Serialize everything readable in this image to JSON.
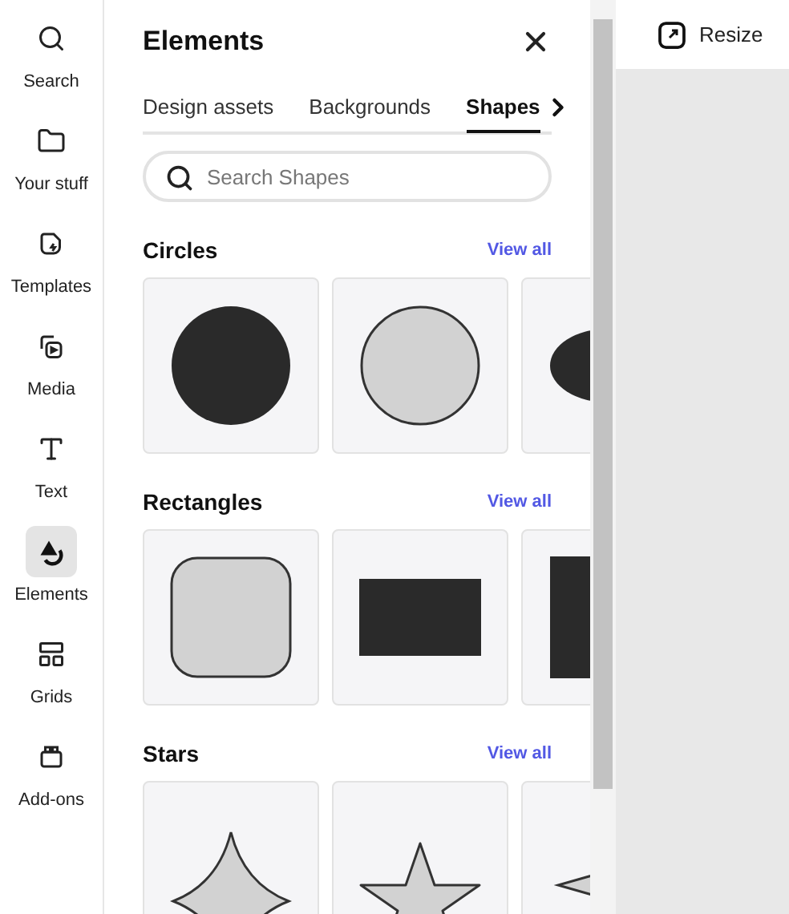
{
  "rail": [
    {
      "label": "Search",
      "kind": "search",
      "selected": false
    },
    {
      "label": "Your stuff",
      "kind": "folder",
      "selected": false
    },
    {
      "label": "Templates",
      "kind": "templates",
      "selected": false
    },
    {
      "label": "Media",
      "kind": "media",
      "selected": false
    },
    {
      "label": "Text",
      "kind": "text",
      "selected": false
    },
    {
      "label": "Elements",
      "kind": "elements",
      "selected": true
    },
    {
      "label": "Grids",
      "kind": "grids",
      "selected": false
    },
    {
      "label": "Add-ons",
      "kind": "addons",
      "selected": false
    }
  ],
  "panel": {
    "title": "Elements",
    "tabs": [
      {
        "label": "Design assets",
        "selected": false
      },
      {
        "label": "Backgrounds",
        "selected": false
      },
      {
        "label": "Shapes",
        "selected": true
      }
    ],
    "search": {
      "placeholder": "Search Shapes"
    },
    "sections": [
      {
        "title": "Circles",
        "link": "View all",
        "tiles": [
          {
            "kind": "dark-circle"
          },
          {
            "kind": "light-circle"
          },
          {
            "kind": "dark-ellipse"
          }
        ]
      },
      {
        "title": "Rectangles",
        "link": "View all",
        "tiles": [
          {
            "kind": "rounded-square"
          },
          {
            "kind": "dark-rectangle"
          },
          {
            "kind": "dark-tall-rectangle"
          }
        ]
      },
      {
        "title": "Stars",
        "link": "View all",
        "tiles": [
          {
            "kind": "four-point-star"
          },
          {
            "kind": "five-point-star"
          },
          {
            "kind": "thin-star"
          }
        ]
      }
    ]
  },
  "topbar": {
    "resize": "Resize"
  }
}
